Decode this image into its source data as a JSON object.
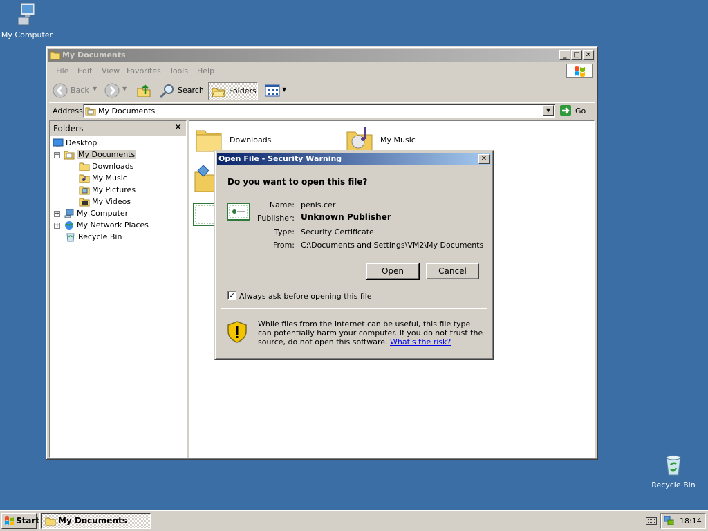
{
  "desktop": {
    "icons": [
      {
        "label": "My Computer",
        "icon": "my-computer-icon"
      },
      {
        "label": "Recycle Bin",
        "icon": "recycle-bin-icon"
      }
    ]
  },
  "explorer": {
    "title": "My Documents",
    "menu": [
      "File",
      "Edit",
      "View",
      "Favorites",
      "Tools",
      "Help"
    ],
    "toolbar": {
      "back": "Back",
      "search": "Search",
      "folders": "Folders"
    },
    "address": {
      "label": "Address",
      "value": "My Documents",
      "go": "Go"
    },
    "folders_pane": {
      "title": "Folders",
      "tree": [
        {
          "label": "Desktop",
          "icon": "desktop-icon"
        },
        {
          "label": "My Documents",
          "icon": "my-documents-icon",
          "selected": true
        },
        {
          "label": "Downloads",
          "icon": "folder-icon"
        },
        {
          "label": "My Music",
          "icon": "my-music-icon"
        },
        {
          "label": "My Pictures",
          "icon": "my-pictures-icon"
        },
        {
          "label": "My Videos",
          "icon": "my-videos-icon"
        },
        {
          "label": "My Computer",
          "icon": "my-computer-icon"
        },
        {
          "label": "My Network Places",
          "icon": "network-places-icon"
        },
        {
          "label": "Recycle Bin",
          "icon": "recycle-bin-icon"
        }
      ]
    },
    "items": [
      {
        "label": "Downloads",
        "icon": "folder-icon"
      },
      {
        "label": "My Music",
        "icon": "my-music-icon"
      }
    ]
  },
  "dialog": {
    "title": "Open File - Security Warning",
    "question": "Do you want to open this file?",
    "fields": {
      "name_label": "Name:",
      "name": "penis.cer",
      "publisher_label": "Publisher:",
      "publisher": "Unknown Publisher",
      "type_label": "Type:",
      "type": "Security Certificate",
      "from_label": "From:",
      "from": "C:\\Documents and Settings\\VM2\\My Documents"
    },
    "open_button": "Open",
    "cancel_button": "Cancel",
    "checkbox": {
      "label": "Always ask before opening this file",
      "checked": true
    },
    "warning_text": "While files from the Internet can be useful, this file type can potentially harm your computer. If you do not trust the source, do not open this software.",
    "risk_link": "What's the risk?"
  },
  "taskbar": {
    "start": "Start",
    "task": "My Documents",
    "clock": "18:14"
  },
  "colors": {
    "desktop": "#3a6ea5",
    "active_title": "#0a246a",
    "inactive_title": "#808080"
  }
}
